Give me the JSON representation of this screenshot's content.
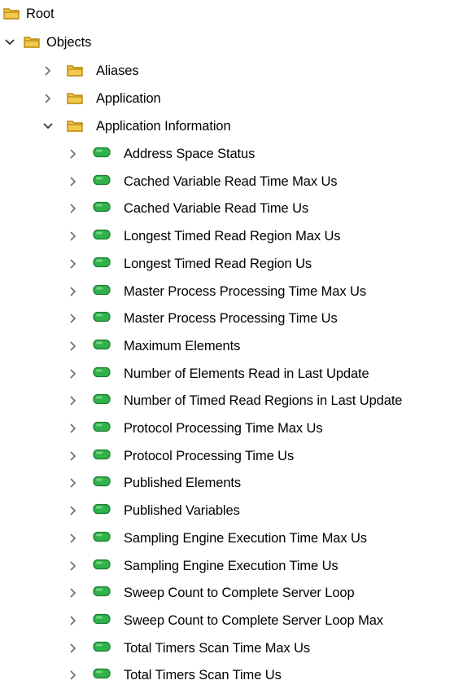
{
  "tree": {
    "root": {
      "label": "Root",
      "icon": "folder-icon"
    },
    "objects": {
      "label": "Objects",
      "icon": "folder-icon",
      "expanded": true
    },
    "aliases": {
      "label": "Aliases",
      "icon": "folder-icon",
      "expanded": false
    },
    "application": {
      "label": "Application",
      "icon": "folder-icon",
      "expanded": false
    },
    "app_info": {
      "label": "Application Information",
      "icon": "folder-icon",
      "expanded": true
    },
    "items": [
      {
        "label": "Address Space Status"
      },
      {
        "label": "Cached Variable Read Time Max Us"
      },
      {
        "label": "Cached Variable Read Time Us"
      },
      {
        "label": "Longest Timed Read Region Max Us"
      },
      {
        "label": "Longest Timed Read Region Us"
      },
      {
        "label": "Master Process Processing Time Max Us"
      },
      {
        "label": "Master Process Processing Time Us"
      },
      {
        "label": "Maximum Elements"
      },
      {
        "label": "Number of Elements Read in Last Update"
      },
      {
        "label": "Number of Timed Read Regions in Last Update"
      },
      {
        "label": "Protocol Processing Time Max Us"
      },
      {
        "label": "Protocol Processing Time Us"
      },
      {
        "label": "Published Elements"
      },
      {
        "label": "Published Variables"
      },
      {
        "label": "Sampling Engine Execution Time Max Us"
      },
      {
        "label": "Sampling Engine Execution Time Us"
      },
      {
        "label": "Sweep Count to Complete Server Loop"
      },
      {
        "label": "Sweep Count to Complete Server Loop Max"
      },
      {
        "label": "Total Timers Scan Time Max Us"
      },
      {
        "label": "Total Timers Scan Time Us"
      }
    ],
    "colors": {
      "folder_fill": "#f2c94c",
      "folder_stroke": "#b8860b",
      "object_fill": "#2fb24a",
      "object_stroke": "#1d7a2f",
      "chevron": "#6b6b6b"
    }
  }
}
